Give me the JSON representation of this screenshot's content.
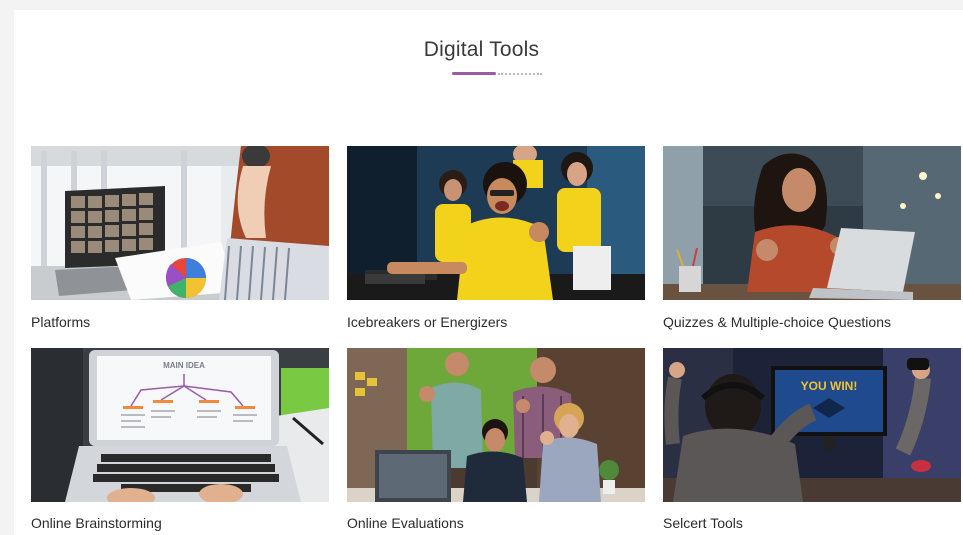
{
  "section": {
    "title": "Digital Tools"
  },
  "tools": [
    {
      "label": "Platforms"
    },
    {
      "label": "Icebreakers or Energizers"
    },
    {
      "label": "Quizzes & Multiple-choice Questions"
    },
    {
      "label": "Online Brainstorming"
    },
    {
      "label": "Online Evaluations"
    },
    {
      "label": "Selcert Tools"
    }
  ],
  "images": {
    "brainstorm_heading": "MAIN IDEA",
    "game_banner": "YOU WIN!"
  },
  "colors": {
    "accent": "#9b5aa8",
    "text": "#2c2c2c",
    "yellow_shirt": "#f2d21b"
  }
}
